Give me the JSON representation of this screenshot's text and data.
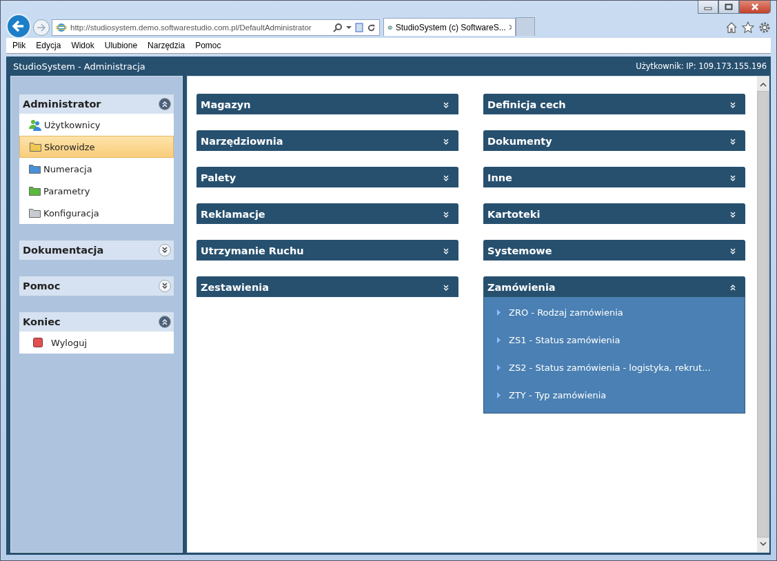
{
  "browser": {
    "url": "http://studiosystem.demo.softwarestudio.com.pl/DefaultAdministrator",
    "tab_title": "StudioSystem (c) SoftwareS...",
    "menu": [
      "Plik",
      "Edycja",
      "Widok",
      "Ulubione",
      "Narzędzia",
      "Pomoc"
    ]
  },
  "app": {
    "title": "StudioSystem - Administracja",
    "user_info": "Użytkownik: IP: 109.173.155.196"
  },
  "sidebar": {
    "groups": [
      {
        "title": "Administrator",
        "expanded": true,
        "items": [
          {
            "label": "Użytkownicy",
            "kind": "users",
            "selected": false
          },
          {
            "label": "Skorowidze",
            "kind": "folder",
            "color": "#f0c850",
            "selected": true
          },
          {
            "label": "Numeracja",
            "kind": "folder",
            "color": "#4a90d8",
            "selected": false
          },
          {
            "label": "Parametry",
            "kind": "folder",
            "color": "#5cb83a",
            "selected": false
          },
          {
            "label": "Konfiguracja",
            "kind": "folder",
            "color": "#c8ccd2",
            "selected": false
          }
        ]
      },
      {
        "title": "Dokumentacja",
        "expanded": false
      },
      {
        "title": "Pomoc",
        "expanded": false
      },
      {
        "title": "Koniec",
        "expanded": true,
        "items": [
          {
            "label": "Wyloguj",
            "kind": "stop",
            "selected": false
          }
        ]
      }
    ]
  },
  "panels": {
    "left": [
      {
        "title": "Magazyn",
        "expanded": false
      },
      {
        "title": "Narzędziownia",
        "expanded": false
      },
      {
        "title": "Palety",
        "expanded": false
      },
      {
        "title": "Reklamacje",
        "expanded": false
      },
      {
        "title": "Utrzymanie Ruchu",
        "expanded": false
      },
      {
        "title": "Zestawienia",
        "expanded": false
      }
    ],
    "right": [
      {
        "title": "Definicja cech",
        "expanded": false
      },
      {
        "title": "Dokumenty",
        "expanded": false
      },
      {
        "title": "Inne",
        "expanded": false
      },
      {
        "title": "Kartoteki",
        "expanded": false
      },
      {
        "title": "Systemowe",
        "expanded": false
      },
      {
        "title": "Zamówienia",
        "expanded": true,
        "items": [
          "ZRO - Rodzaj zamówienia",
          "ZS1 - Status zamówienia",
          "ZS2 - Status zamówienia - logistyka, rekrut...",
          "ZTY - Typ zamówienia"
        ]
      }
    ]
  }
}
